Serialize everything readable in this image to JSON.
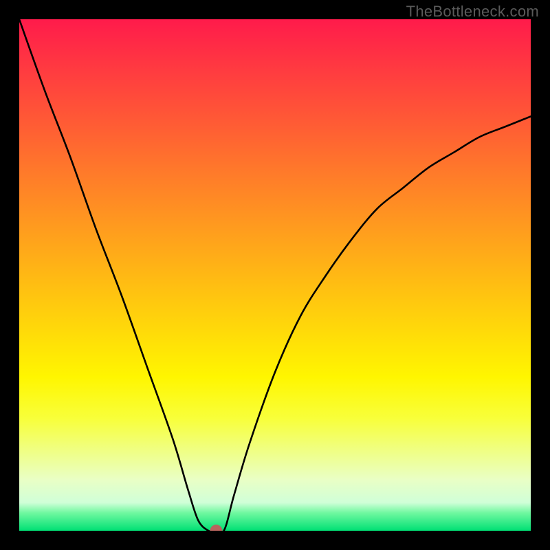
{
  "watermark": "TheBottleneck.com",
  "chart_data": {
    "type": "line",
    "title": "",
    "xlabel": "",
    "ylabel": "",
    "xlim": [
      0,
      100
    ],
    "ylim": [
      0,
      100
    ],
    "series": [
      {
        "name": "curve",
        "x": [
          0,
          5,
          10,
          15,
          20,
          25,
          30,
          33,
          35,
          37,
          38,
          40,
          42,
          45,
          50,
          55,
          60,
          65,
          70,
          75,
          80,
          85,
          90,
          95,
          100
        ],
        "y": [
          100,
          86,
          73,
          59,
          46,
          32,
          18,
          8,
          2,
          0,
          0,
          0,
          7,
          17,
          31,
          42,
          50,
          57,
          63,
          67,
          71,
          74,
          77,
          79,
          81
        ]
      }
    ],
    "marker": {
      "x": 38.5,
      "y": 0,
      "color": "#b9645e",
      "r": 1.2
    },
    "gradient_stops": [
      {
        "offset": 0.0,
        "color": "#ff1b4b"
      },
      {
        "offset": 0.1,
        "color": "#ff3b40"
      },
      {
        "offset": 0.2,
        "color": "#ff5a35"
      },
      {
        "offset": 0.3,
        "color": "#ff7a2a"
      },
      {
        "offset": 0.4,
        "color": "#ff991f"
      },
      {
        "offset": 0.5,
        "color": "#ffb814"
      },
      {
        "offset": 0.6,
        "color": "#ffd70a"
      },
      {
        "offset": 0.7,
        "color": "#fff600"
      },
      {
        "offset": 0.78,
        "color": "#f8ff3a"
      },
      {
        "offset": 0.84,
        "color": "#f0ff80"
      },
      {
        "offset": 0.9,
        "color": "#e9ffc5"
      },
      {
        "offset": 0.945,
        "color": "#d0ffd8"
      },
      {
        "offset": 0.965,
        "color": "#70f8a0"
      },
      {
        "offset": 1.0,
        "color": "#00e074"
      }
    ]
  }
}
